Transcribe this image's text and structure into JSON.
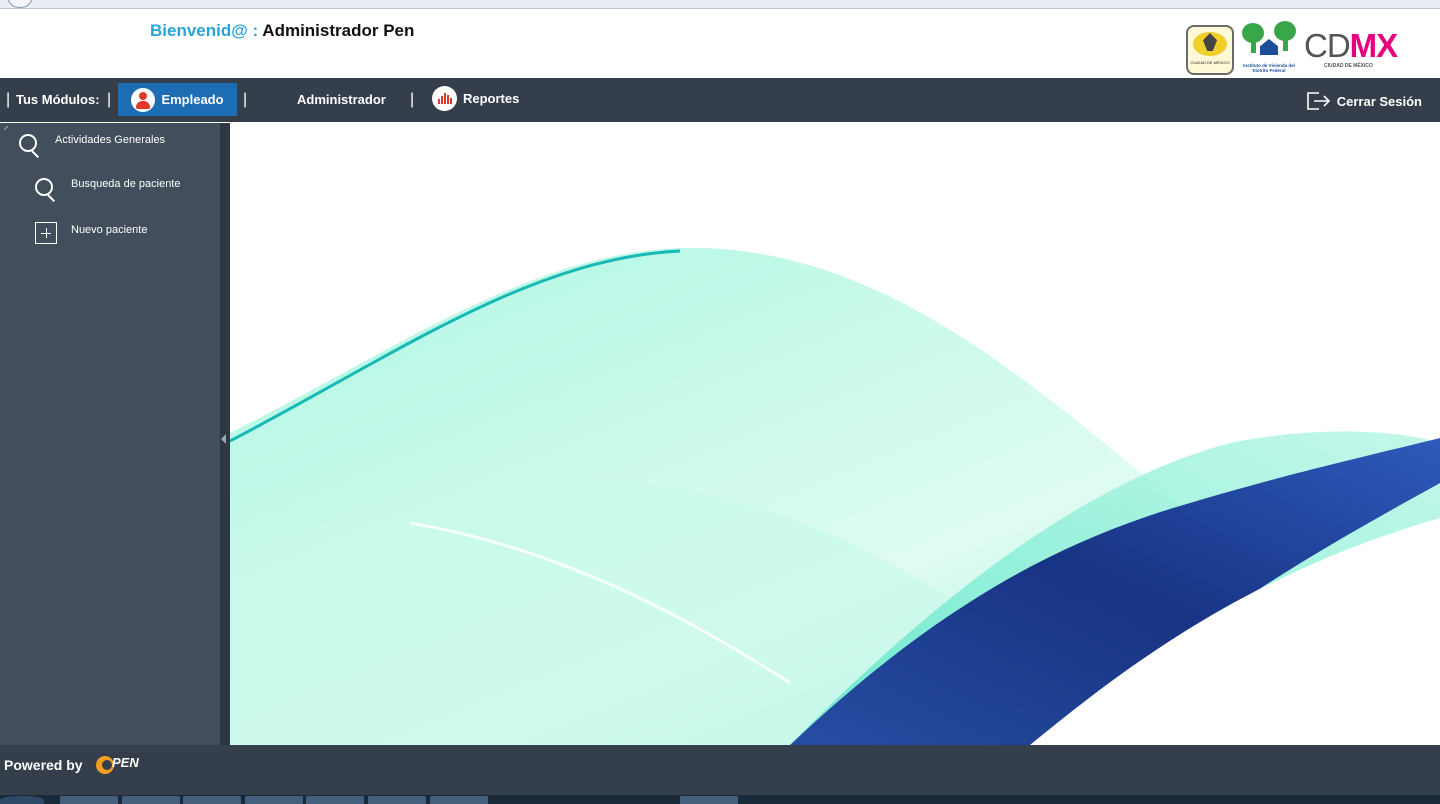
{
  "header": {
    "greeting": "Bienvenid@ :",
    "user_name": "Administrador Pen",
    "logos": {
      "seal_text": "CIUDAD DE MÉXICO",
      "invi_text": "Instituto de Vivienda del Distrito Federal",
      "cdmx_cd": "CD",
      "cdmx_mx": "MX",
      "cdmx_sub": "CIUDAD DE MÉXICO"
    }
  },
  "navbar": {
    "modules_label": "Tus Módulos:",
    "empleado": "Empleado",
    "administrador": "Administrador",
    "reportes": "Reportes",
    "logout": "Cerrar Sesión"
  },
  "sidebar": {
    "items": [
      {
        "label": "Actividades Generales",
        "icon": "search-icon"
      },
      {
        "label": "Busqueda de paciente",
        "icon": "search-icon"
      },
      {
        "label": "Nuevo paciente",
        "icon": "plus-icon"
      }
    ]
  },
  "footer": {
    "powered_by": "Powered by",
    "brand": "PEN"
  },
  "colors": {
    "navbar": "#343f4b",
    "sidebar": "#424e5b",
    "active_tab": "#1d6db5",
    "greeting": "#2aa3d8",
    "wave_light": "#7ff0d4",
    "wave_dark": "#1a2f9a"
  }
}
